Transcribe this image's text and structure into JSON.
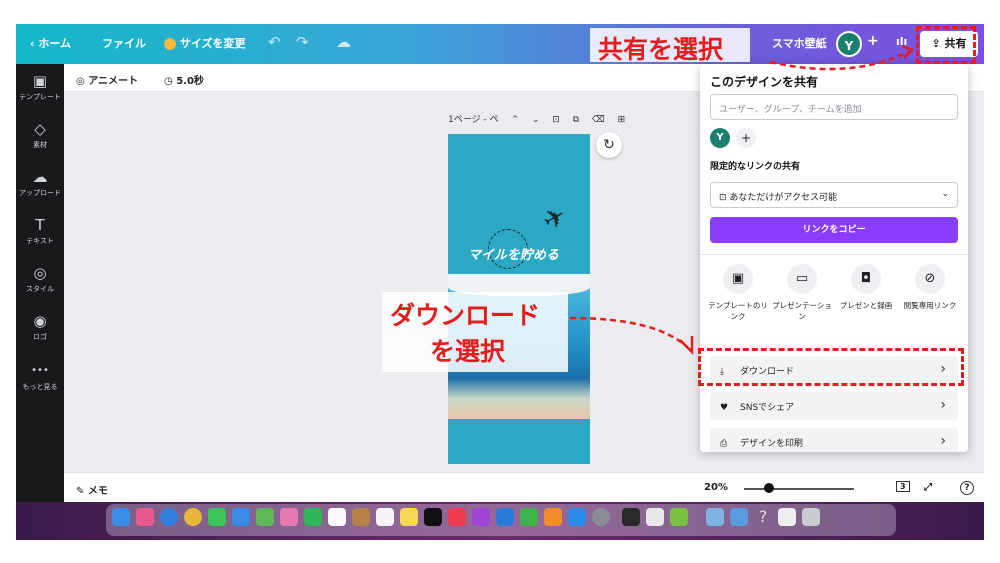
{
  "topbar": {
    "home": "‹ ホーム",
    "file": "ファイル",
    "resize": "サイズを変更",
    "design_name": "スマホ壁紙",
    "avatar": "Y",
    "share": "共有"
  },
  "sidebar": {
    "items": [
      {
        "icon": "▣",
        "label": "テンプレート"
      },
      {
        "icon": "◇",
        "label": "素材"
      },
      {
        "icon": "☁",
        "label": "アップロード"
      },
      {
        "icon": "T",
        "label": "テキスト"
      },
      {
        "icon": "◎",
        "label": "スタイル"
      },
      {
        "icon": "◉",
        "label": "ロゴ"
      },
      {
        "icon": "•••",
        "label": "もっと見る"
      }
    ]
  },
  "subbar": {
    "animate": "アニメート",
    "duration": "5.0秒"
  },
  "canvas": {
    "page_label": "1ページ - ペ",
    "design_title": "マイルを貯める"
  },
  "bottombar": {
    "memo": "メモ",
    "zoom": "20%",
    "page_count": "3",
    "help": "?"
  },
  "share_panel": {
    "title": "このデザインを共有",
    "input_placeholder": "ユーザー、グループ、チームを追加",
    "avatar": "Y",
    "link_heading": "限定的なリンクの共有",
    "access": "あなただけがアクセス可能",
    "copy_link": "リンクをコピー",
    "options": [
      {
        "icon": "▣",
        "label": "テンプレートのリンク"
      },
      {
        "icon": "▭",
        "label": "プレゼンテーション"
      },
      {
        "icon": "◘",
        "label": "プレゼンと録画"
      },
      {
        "icon": "⊘",
        "label": "閲覧専用リンク"
      }
    ],
    "rows": [
      {
        "icon": "⤓",
        "label": "ダウンロード"
      },
      {
        "icon": "♥",
        "label": "SNSでシェア"
      },
      {
        "icon": "⎙",
        "label": "デザインを印刷"
      }
    ]
  },
  "annotations": {
    "share_note": "共有を選択",
    "download_note_1": "ダウンロード",
    "download_note_2": "を選択"
  },
  "colors": {
    "accent": "#8b3dff",
    "annotation": "#e41c1c"
  }
}
